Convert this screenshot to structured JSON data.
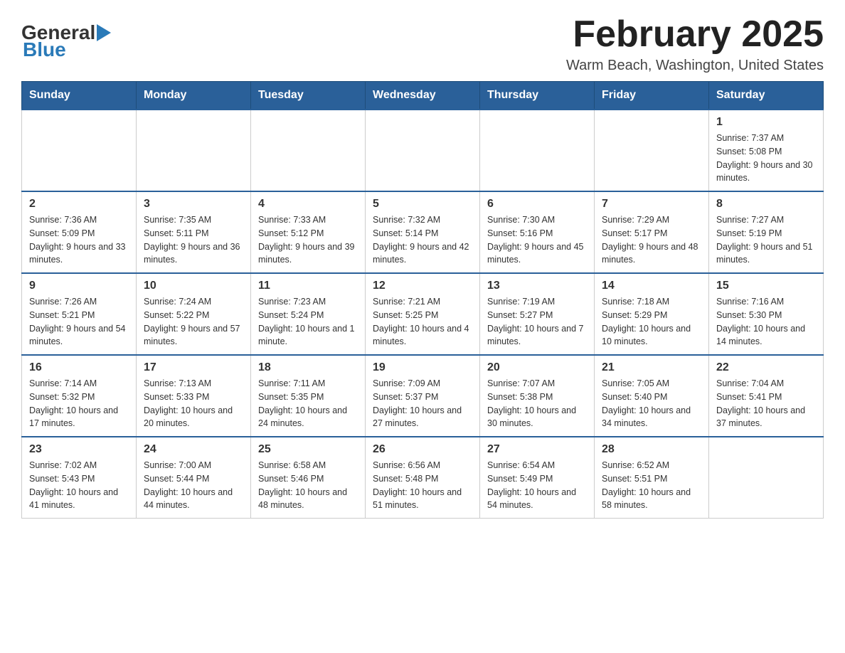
{
  "header": {
    "logo_general": "General",
    "logo_blue": "Blue",
    "month_title": "February 2025",
    "location": "Warm Beach, Washington, United States"
  },
  "days_of_week": [
    "Sunday",
    "Monday",
    "Tuesday",
    "Wednesday",
    "Thursday",
    "Friday",
    "Saturday"
  ],
  "weeks": [
    {
      "days": [
        {
          "date": "",
          "info": ""
        },
        {
          "date": "",
          "info": ""
        },
        {
          "date": "",
          "info": ""
        },
        {
          "date": "",
          "info": ""
        },
        {
          "date": "",
          "info": ""
        },
        {
          "date": "",
          "info": ""
        },
        {
          "date": "1",
          "info": "Sunrise: 7:37 AM\nSunset: 5:08 PM\nDaylight: 9 hours and 30 minutes."
        }
      ]
    },
    {
      "days": [
        {
          "date": "2",
          "info": "Sunrise: 7:36 AM\nSunset: 5:09 PM\nDaylight: 9 hours and 33 minutes."
        },
        {
          "date": "3",
          "info": "Sunrise: 7:35 AM\nSunset: 5:11 PM\nDaylight: 9 hours and 36 minutes."
        },
        {
          "date": "4",
          "info": "Sunrise: 7:33 AM\nSunset: 5:12 PM\nDaylight: 9 hours and 39 minutes."
        },
        {
          "date": "5",
          "info": "Sunrise: 7:32 AM\nSunset: 5:14 PM\nDaylight: 9 hours and 42 minutes."
        },
        {
          "date": "6",
          "info": "Sunrise: 7:30 AM\nSunset: 5:16 PM\nDaylight: 9 hours and 45 minutes."
        },
        {
          "date": "7",
          "info": "Sunrise: 7:29 AM\nSunset: 5:17 PM\nDaylight: 9 hours and 48 minutes."
        },
        {
          "date": "8",
          "info": "Sunrise: 7:27 AM\nSunset: 5:19 PM\nDaylight: 9 hours and 51 minutes."
        }
      ]
    },
    {
      "days": [
        {
          "date": "9",
          "info": "Sunrise: 7:26 AM\nSunset: 5:21 PM\nDaylight: 9 hours and 54 minutes."
        },
        {
          "date": "10",
          "info": "Sunrise: 7:24 AM\nSunset: 5:22 PM\nDaylight: 9 hours and 57 minutes."
        },
        {
          "date": "11",
          "info": "Sunrise: 7:23 AM\nSunset: 5:24 PM\nDaylight: 10 hours and 1 minute."
        },
        {
          "date": "12",
          "info": "Sunrise: 7:21 AM\nSunset: 5:25 PM\nDaylight: 10 hours and 4 minutes."
        },
        {
          "date": "13",
          "info": "Sunrise: 7:19 AM\nSunset: 5:27 PM\nDaylight: 10 hours and 7 minutes."
        },
        {
          "date": "14",
          "info": "Sunrise: 7:18 AM\nSunset: 5:29 PM\nDaylight: 10 hours and 10 minutes."
        },
        {
          "date": "15",
          "info": "Sunrise: 7:16 AM\nSunset: 5:30 PM\nDaylight: 10 hours and 14 minutes."
        }
      ]
    },
    {
      "days": [
        {
          "date": "16",
          "info": "Sunrise: 7:14 AM\nSunset: 5:32 PM\nDaylight: 10 hours and 17 minutes."
        },
        {
          "date": "17",
          "info": "Sunrise: 7:13 AM\nSunset: 5:33 PM\nDaylight: 10 hours and 20 minutes."
        },
        {
          "date": "18",
          "info": "Sunrise: 7:11 AM\nSunset: 5:35 PM\nDaylight: 10 hours and 24 minutes."
        },
        {
          "date": "19",
          "info": "Sunrise: 7:09 AM\nSunset: 5:37 PM\nDaylight: 10 hours and 27 minutes."
        },
        {
          "date": "20",
          "info": "Sunrise: 7:07 AM\nSunset: 5:38 PM\nDaylight: 10 hours and 30 minutes."
        },
        {
          "date": "21",
          "info": "Sunrise: 7:05 AM\nSunset: 5:40 PM\nDaylight: 10 hours and 34 minutes."
        },
        {
          "date": "22",
          "info": "Sunrise: 7:04 AM\nSunset: 5:41 PM\nDaylight: 10 hours and 37 minutes."
        }
      ]
    },
    {
      "days": [
        {
          "date": "23",
          "info": "Sunrise: 7:02 AM\nSunset: 5:43 PM\nDaylight: 10 hours and 41 minutes."
        },
        {
          "date": "24",
          "info": "Sunrise: 7:00 AM\nSunset: 5:44 PM\nDaylight: 10 hours and 44 minutes."
        },
        {
          "date": "25",
          "info": "Sunrise: 6:58 AM\nSunset: 5:46 PM\nDaylight: 10 hours and 48 minutes."
        },
        {
          "date": "26",
          "info": "Sunrise: 6:56 AM\nSunset: 5:48 PM\nDaylight: 10 hours and 51 minutes."
        },
        {
          "date": "27",
          "info": "Sunrise: 6:54 AM\nSunset: 5:49 PM\nDaylight: 10 hours and 54 minutes."
        },
        {
          "date": "28",
          "info": "Sunrise: 6:52 AM\nSunset: 5:51 PM\nDaylight: 10 hours and 58 minutes."
        },
        {
          "date": "",
          "info": ""
        }
      ]
    }
  ]
}
